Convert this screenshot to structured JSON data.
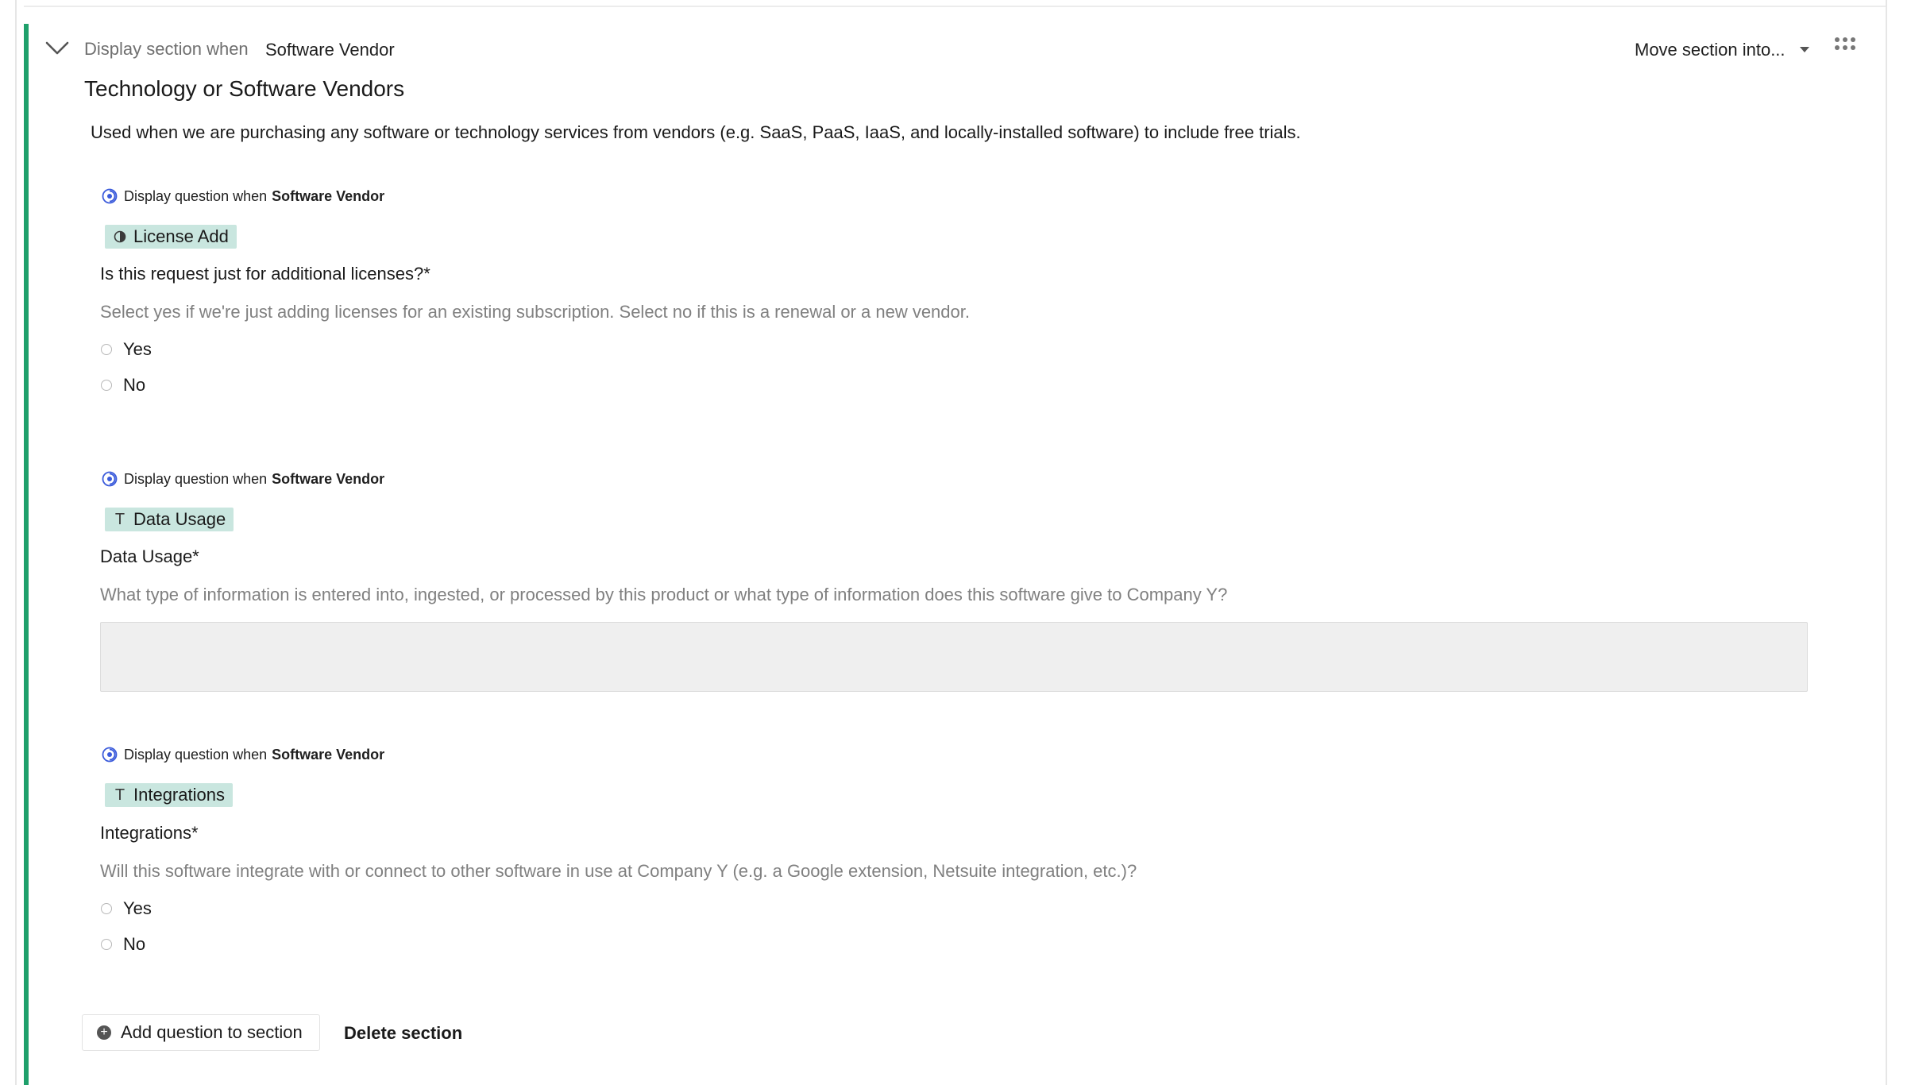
{
  "section": {
    "condition_label": "Display section when",
    "condition_value": "Software Vendor",
    "move_label": "Move section into...",
    "title": "Technology or Software Vendors",
    "description": "Used when we are purchasing any software or technology services from vendors (e.g. SaaS, PaaS, IaaS, and locally-installed software) to include free trials.",
    "accent_color": "#1fa06b"
  },
  "questions": [
    {
      "condition_label": "Display question when",
      "condition_value": "Software Vendor",
      "tag": "License Add",
      "tag_icon": "half-circle-icon",
      "label": "Is this request just for additional licenses?*",
      "help": "Select yes if we're just adding licenses for an existing subscription. Select no if this is a renewal or a new vendor.",
      "options": [
        "Yes",
        "No"
      ]
    },
    {
      "condition_label": "Display question when",
      "condition_value": "Software Vendor",
      "tag": "Data Usage",
      "tag_icon": "text-icon",
      "label": "Data Usage*",
      "help": "What type of information is entered into, ingested, or processed by this product or what type of information does this software give to Company Y?",
      "value": ""
    },
    {
      "condition_label": "Display question when",
      "condition_value": "Software Vendor",
      "tag": "Integrations",
      "tag_icon": "text-icon",
      "label": "Integrations*",
      "help": "Will this software integrate with or connect to other software in use at Company Y (e.g. a Google extension, Netsuite integration, etc.)?",
      "options": [
        "Yes",
        "No"
      ]
    }
  ],
  "actions": {
    "add_question": "Add question to section",
    "delete_section": "Delete section"
  },
  "colors": {
    "tag_background": "#c9e6df",
    "eye_icon": "#3b5bdb"
  }
}
